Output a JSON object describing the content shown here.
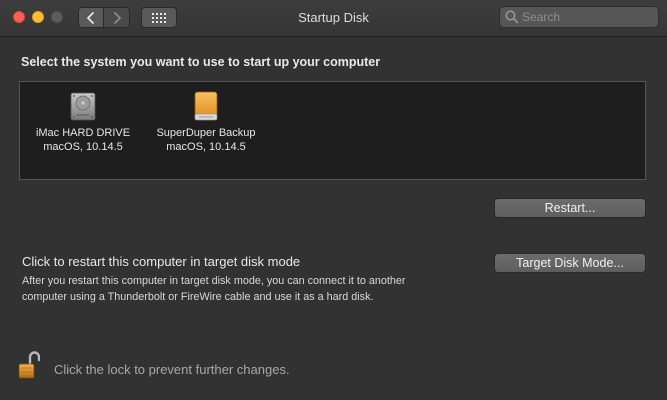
{
  "window": {
    "title": "Startup Disk"
  },
  "toolbar": {
    "back_icon": "chevron-left-icon",
    "forward_icon": "chevron-right-icon",
    "show_all_icon": "grid-icon"
  },
  "search": {
    "placeholder": "Search",
    "value": ""
  },
  "main": {
    "heading": "Select the system you want to use to start up your computer",
    "disks": [
      {
        "name": "iMac HARD DRIVE",
        "os": "macOS, 10.14.5",
        "icon": "internal-drive-icon"
      },
      {
        "name": "SuperDuper Backup",
        "os": "macOS, 10.14.5",
        "icon": "external-drive-icon"
      }
    ],
    "restart_label": "Restart...",
    "target_mode": {
      "title": "Click to restart this computer in target disk mode",
      "description": "After you restart this computer in target disk mode, you can connect it to another computer using a Thunderbolt or FireWire cable and use it as a hard disk.",
      "button_label": "Target Disk Mode..."
    }
  },
  "footer": {
    "lock_text": "Click the lock to prevent further changes."
  },
  "colors": {
    "close": "#fe5f57",
    "minimize": "#febc2e",
    "external_drive": "#f0a030"
  }
}
